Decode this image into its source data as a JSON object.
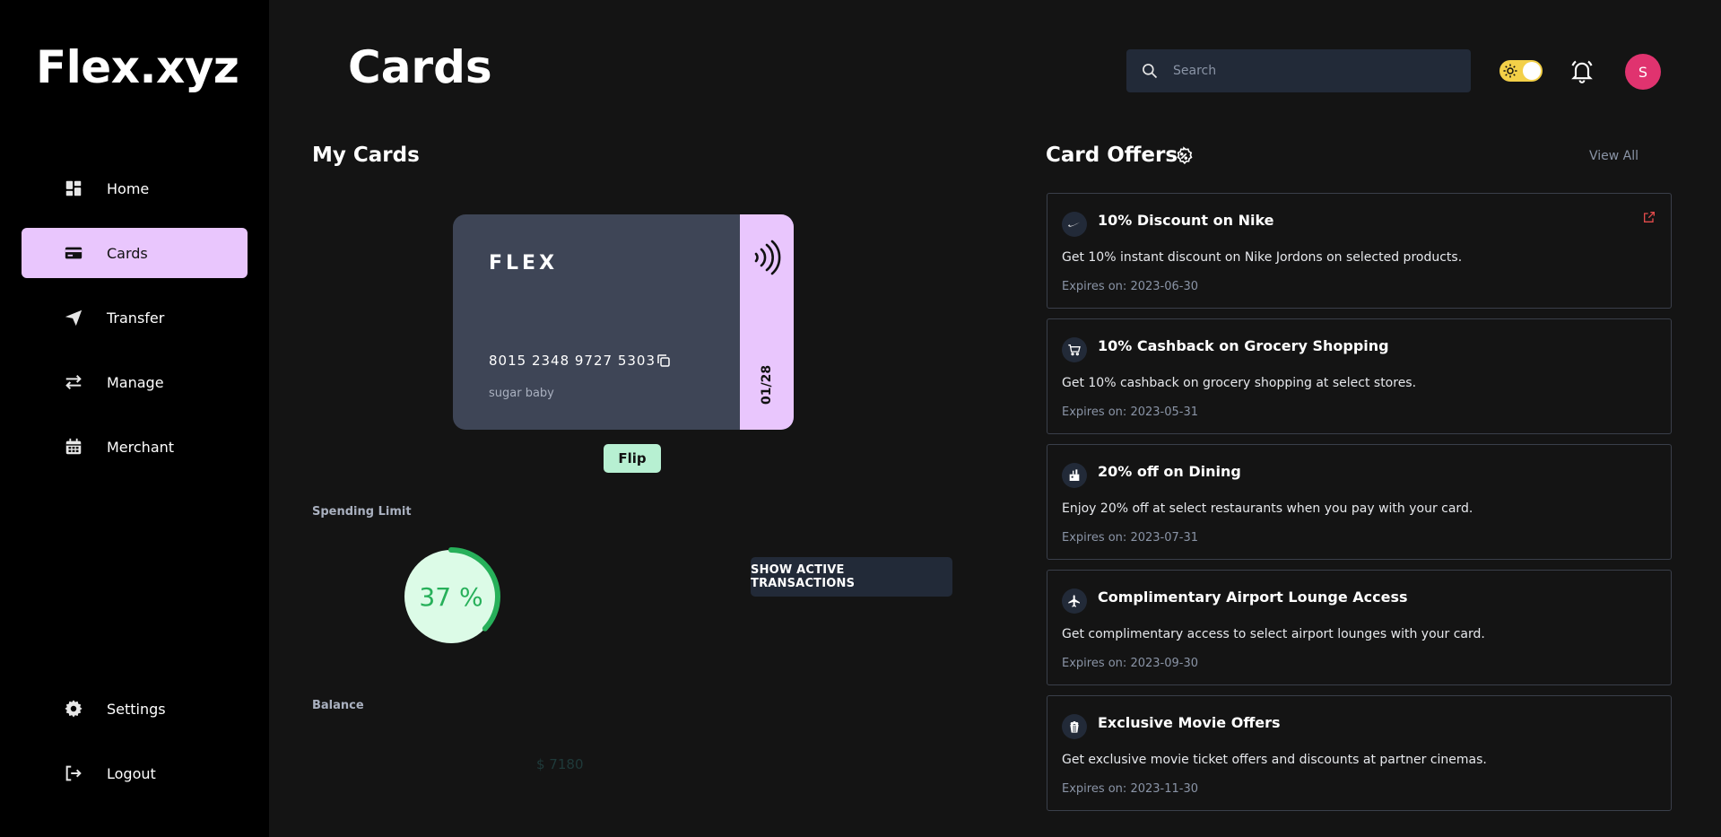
{
  "app": {
    "logo": "Flex.xyz"
  },
  "sidebar": {
    "items": [
      {
        "label": "Home",
        "icon": "dashboard-icon"
      },
      {
        "label": "Cards",
        "icon": "credit-card-icon",
        "active": true
      },
      {
        "label": "Transfer",
        "icon": "paper-plane-icon"
      },
      {
        "label": "Manage",
        "icon": "swap-arrows-icon"
      },
      {
        "label": "Merchant",
        "icon": "calendar-icon"
      }
    ],
    "bottom": [
      {
        "label": "Settings",
        "icon": "gear-icon"
      },
      {
        "label": "Logout",
        "icon": "logout-icon"
      }
    ]
  },
  "header": {
    "title": "Cards",
    "search_placeholder": "Search",
    "avatar_initial": "S"
  },
  "my_cards": {
    "title": "My Cards",
    "card": {
      "brand": "FLEX",
      "number": "8015 2348 9727 5303",
      "holder": "sugar baby",
      "expiry": "01/28",
      "colors": {
        "body": "#3e4556",
        "stripe": "#e9c6fd"
      }
    },
    "flip_label": "Flip",
    "spending_limit_label": "Spending Limit",
    "spending_limit_percent": 37,
    "spending_limit_text": "37 %",
    "show_transactions_label": "SHOW ACTIVE TRANSACTIONS",
    "balance_label": "Balance",
    "balance_value": "$ 7180"
  },
  "offers": {
    "title": "Card Offers",
    "view_all": "View All",
    "items": [
      {
        "title": "10% Discount on Nike",
        "desc": "Get 10% instant discount on Nike Jordons on selected products.",
        "expiry": "Expires on: 2023-06-30",
        "icon": "nike-swoosh-icon"
      },
      {
        "title": "10% Cashback on Grocery Shopping",
        "desc": "Get 10% cashback on grocery shopping at select stores.",
        "expiry": "Expires on: 2023-05-31",
        "icon": "shopping-cart-icon"
      },
      {
        "title": "20% off on Dining",
        "desc": "Enjoy 20% off at select restaurants when you pay with your card.",
        "expiry": "Expires on: 2023-07-31",
        "icon": "restaurant-icon"
      },
      {
        "title": "Complimentary Airport Lounge Access",
        "desc": "Get complimentary access to select airport lounges with your card.",
        "expiry": "Expires on: 2023-09-30",
        "icon": "airplane-icon"
      },
      {
        "title": "Exclusive Movie Offers",
        "desc": "Get exclusive movie ticket offers and discounts at partner cinemas.",
        "expiry": "Expires on: 2023-11-30",
        "icon": "popcorn-icon"
      }
    ]
  },
  "colors": {
    "accent": "#e9c6fd",
    "background": "#141414",
    "sidebar": "#000000",
    "gauge": "#27b05a",
    "avatar": "#e0336f"
  }
}
